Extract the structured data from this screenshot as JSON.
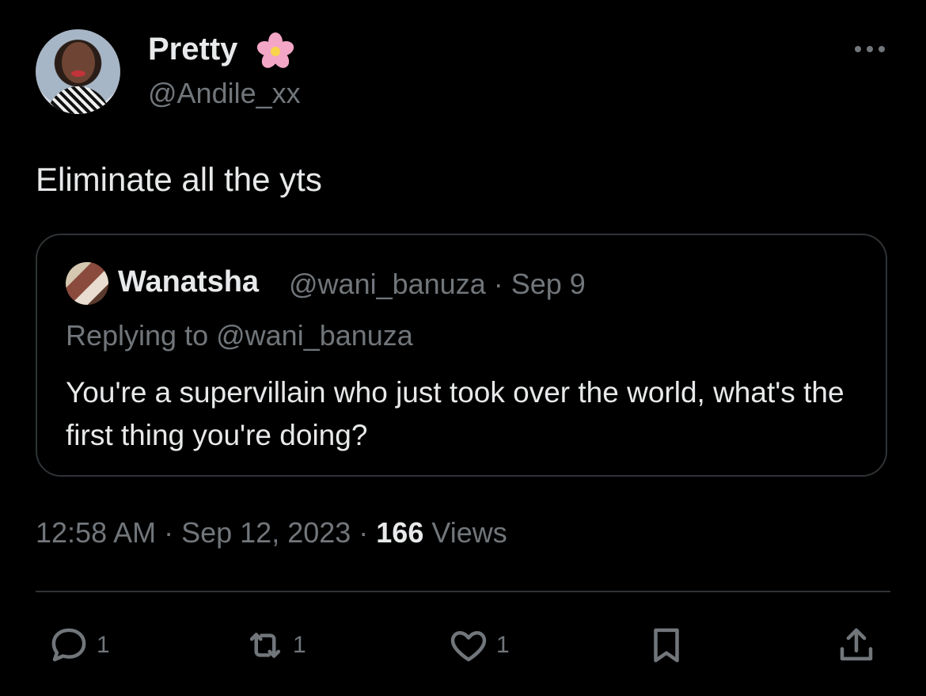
{
  "author": {
    "display_name": "Pretty",
    "handle": "@Andile_xx",
    "badge_icon": "cherry-blossom-icon"
  },
  "tweet": {
    "text": "Eliminate all the yts"
  },
  "quoted_tweet": {
    "display_name": "Wanatsha",
    "meta": "@wani_banuza · Sep 9",
    "replying_to": "Replying to @wani_banuza",
    "text": "You're a supervillain who just took over the world, what's the first thing you're doing?"
  },
  "meta": {
    "time_date": "12:58 AM · Sep 12, 2023 · ",
    "views_count": "166",
    "views_label": " Views"
  },
  "actions": {
    "reply_count": "1",
    "retweet_count": "1",
    "like_count": "1"
  },
  "colors": {
    "background": "#000000",
    "primary_text": "#e7e9ea",
    "secondary_text": "#71767b",
    "border": "#2f3336"
  }
}
